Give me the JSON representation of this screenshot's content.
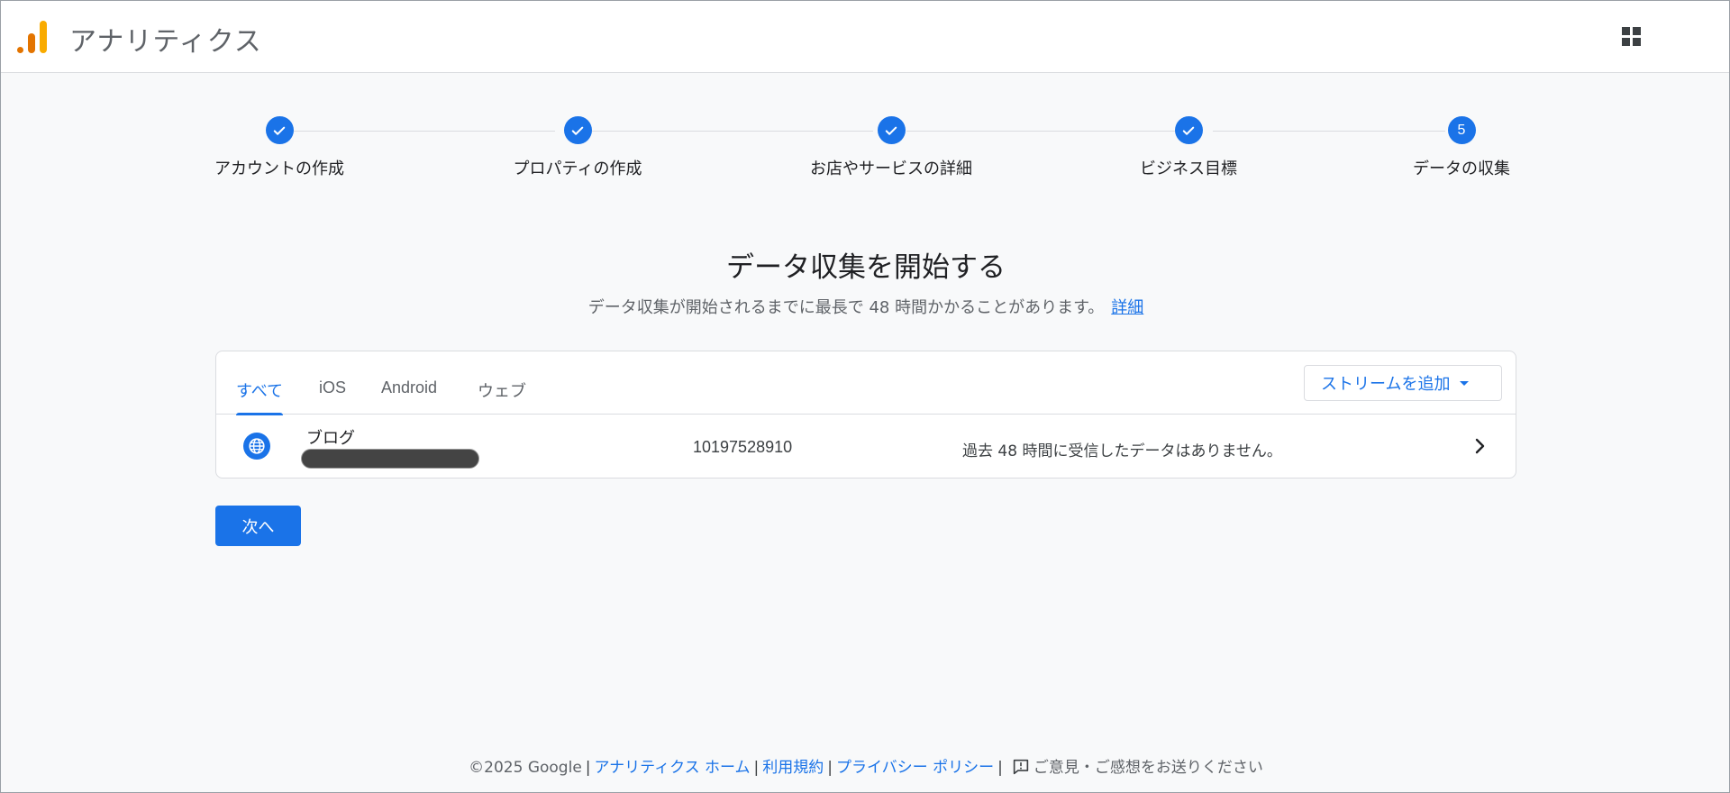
{
  "header": {
    "app_title": "アナリティクス",
    "apps_icon": "apps-grid-icon"
  },
  "stepper": {
    "steps": [
      {
        "label": "アカウントの作成",
        "state": "completed"
      },
      {
        "label": "プロパティの作成",
        "state": "completed"
      },
      {
        "label": "お店やサービスの詳細",
        "state": "completed"
      },
      {
        "label": "ビジネス目標",
        "state": "completed"
      },
      {
        "label": "データの収集",
        "state": "current",
        "number": "5"
      }
    ]
  },
  "main": {
    "heading": "データ収集を開始する",
    "subheading": "データ収集が開始されるまでに最長で 48 時間かかることがあります。",
    "details_link": "詳細"
  },
  "streams": {
    "tabs": [
      {
        "label": "すべて",
        "active": true
      },
      {
        "label": "iOS",
        "active": false
      },
      {
        "label": "Android",
        "active": false
      },
      {
        "label": "ウェブ",
        "active": false
      }
    ],
    "add_stream_label": "ストリームを追加",
    "rows": [
      {
        "icon": "globe-icon",
        "name": "ブログ",
        "url": "[redacted]",
        "stream_id": "10197528910",
        "status": "過去 48 時間に受信したデータはありません。"
      }
    ]
  },
  "actions": {
    "next_label": "次へ"
  },
  "footer": {
    "copyright": "©2025 Google",
    "separator": "|",
    "home_link": "アナリティクス ホーム",
    "terms_link": "利用規約",
    "privacy_link": "プライバシー ポリシー",
    "feedback_label": "ご意見・ご感想をお送りください"
  },
  "colors": {
    "accent": "#1a73e8",
    "logo_orange": "#e37400",
    "logo_yellow": "#f9ab00",
    "background": "#f8f9fa"
  }
}
